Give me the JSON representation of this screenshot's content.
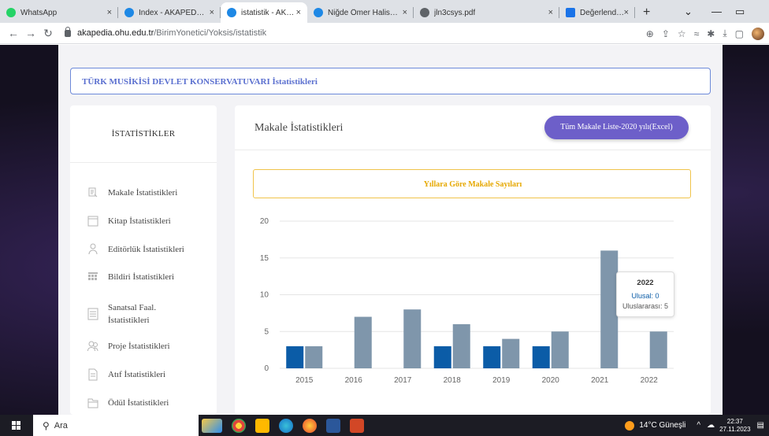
{
  "browser": {
    "tabs": [
      {
        "label": "WhatsApp",
        "color": "#25d366",
        "active": false
      },
      {
        "label": "Index - AKAPEDİA | A",
        "color": "#1e88e5",
        "active": false
      },
      {
        "label": "istatistik - AKAPEDİA",
        "color": "#1e88e5",
        "active": true
      },
      {
        "label": "Niğde Ömer Halisden",
        "color": "#1e88e5",
        "active": false
      },
      {
        "label": "jln3csys.pdf",
        "color": "#5f6368",
        "active": false
      },
      {
        "label": "Değerlendirme Kılavu",
        "color": "#1a73e8",
        "active": false
      }
    ],
    "close_glyph": "×",
    "newtab_glyph": "+",
    "url_host": "akapedia.ohu.edu.tr",
    "url_path": "/BirimYonetici/Yoksis/istatistik"
  },
  "page": {
    "header_title": "TÜRK MUSİKİSİ DEVLET KONSERVATUVARI İstatistikleri",
    "sidebar": {
      "title": "İSTATİSTİKLER",
      "items": [
        {
          "label": "Makale İstatistikleri",
          "icon": "article-icon"
        },
        {
          "label": "Kitap İstatistikleri",
          "icon": "book-icon"
        },
        {
          "label": "Editörlük İstatistikleri",
          "icon": "editor-icon"
        },
        {
          "label": "Bildiri İstatistikleri",
          "icon": "calendar-icon"
        },
        {
          "label": "Sanatsal Faal.",
          "label2": "İstatistikleri",
          "icon": "list-icon"
        },
        {
          "label": "Proje İstatistikleri",
          "icon": "users-icon"
        },
        {
          "label": "Atıf İstatistikleri",
          "icon": "document-icon"
        },
        {
          "label": "Ödül İstatistikleri",
          "icon": "folder-icon"
        }
      ]
    },
    "main": {
      "title": "Makale İstatistikleri",
      "excel_button": "Tüm Makale Liste-2020 yılı(Excel)",
      "chart_heading": "Yıllara Göre Makale Sayıları"
    },
    "tooltip": {
      "title": "2022",
      "line1": "Ulusal: 0",
      "line2": "Uluslararası: 5"
    }
  },
  "chart_data": {
    "type": "bar",
    "categories": [
      "2015",
      "2016",
      "2017",
      "2018",
      "2019",
      "2020",
      "2021",
      "2022"
    ],
    "series": [
      {
        "name": "Ulusal",
        "color": "#0b5ca7",
        "values": [
          3,
          0,
          0,
          3,
          3,
          3,
          0,
          0
        ]
      },
      {
        "name": "Uluslararası",
        "color": "#7f96ab",
        "values": [
          3,
          7,
          8,
          6,
          4,
          5,
          16,
          5
        ]
      }
    ],
    "yticks": [
      0,
      5,
      10,
      15,
      20
    ],
    "ylim": [
      0,
      20
    ],
    "grid": true
  },
  "taskbar": {
    "search_label": "Ara",
    "weather": "14°C Güneşli",
    "time": "22:37",
    "date": "27.11.2023"
  },
  "colors": {
    "accent": "#6d5fc9",
    "header_border": "#6d8ad9",
    "chart_heading": "#e6a800"
  }
}
